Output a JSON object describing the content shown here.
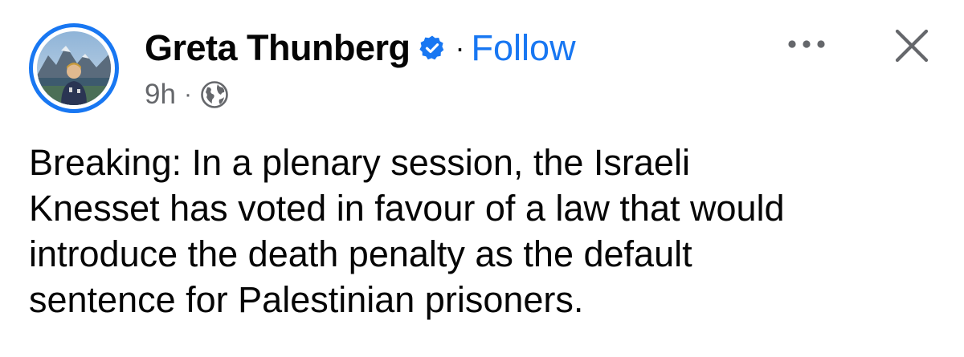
{
  "post": {
    "author": "Greta Thunberg",
    "separator": "·",
    "follow_label": "Follow",
    "timestamp": "9h",
    "meta_separator": "·",
    "audience_icon": "globe-icon",
    "verified_icon": "verified-badge-icon",
    "more_icon": "more-options-icon",
    "close_icon": "close-icon",
    "text_lines": [
      "Breaking: In a plenary session, the Israeli",
      "Knesset has voted in favour of a law that would",
      "introduce the death penalty as the default",
      "sentence for Palestinian prisoners."
    ]
  },
  "colors": {
    "accent": "#1877f2",
    "text_primary": "#050505",
    "text_secondary": "#65676b",
    "background": "#ffffff"
  }
}
